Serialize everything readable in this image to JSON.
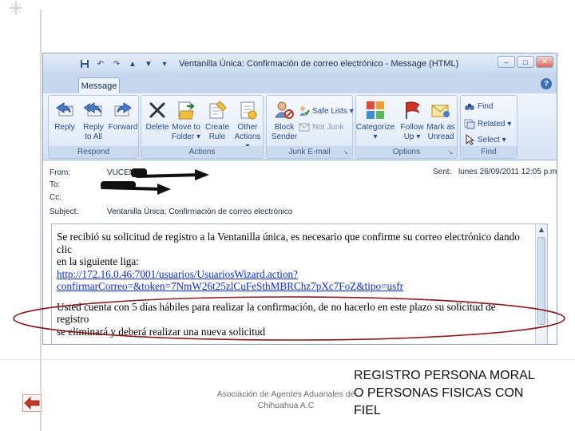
{
  "window": {
    "title": "Ventanilla Única: Confirmación de correo electrónico - Message (HTML)",
    "tab": "Message",
    "controls": [
      "–",
      "□",
      "✕"
    ]
  },
  "ribbon": {
    "respond": {
      "label": "Respond",
      "reply": "Reply",
      "reply_all": "Reply\nto All",
      "forward": "Forward"
    },
    "actions": {
      "label": "Actions",
      "delete": "Delete",
      "move_to_folder": "Move to\nFolder ▾",
      "create_rule": "Create\nRule",
      "other_actions": "Other\nActions ▾"
    },
    "junk": {
      "label": "Junk E-mail",
      "block_sender": "Block\nSender",
      "safe_lists": "Safe Lists ▾",
      "not_junk": "Not Junk"
    },
    "options": {
      "label": "Options",
      "categorize": "Categorize\n▾",
      "follow_up": "Follow\nUp ▾",
      "mark_as_unread": "Mark as\nUnread"
    },
    "find": {
      "label": "Find",
      "find": "Find",
      "related": "Related ▾",
      "select": "Select ▾"
    }
  },
  "headers": {
    "from_label": "From:",
    "from_value": "VUCEM",
    "to_label": "To:",
    "cc_label": "Cc:",
    "subject_label": "Subject:",
    "subject_value": "Ventanilla Única: Confirmación de correo electrónico",
    "sent_label": "Sent:",
    "sent_value": "lunes 26/09/2011 12:05 p.m."
  },
  "message": {
    "line1": "Se recibió su solicitud de registro a la Ventanilla única, es necesario que confirme su correo electrónico dando clic",
    "line2": "en la siguiente liga:",
    "link1": "http://172.16.0.46:7001/usuarios/UsuariosWizard.action?",
    "link2": "confirmarCorreo=&token=7NmW26t25zlCuFeSthMBRChz7pXc7FoZ&tipo=usfr",
    "notice1": "Usted cuenta con 5 días hábiles para realizar la confirmación, de no hacerlo en este plazo su solicitud de registro",
    "notice2": "se eliminará y deberá realizar una nueva solicitud"
  },
  "footer": {
    "assoc_line1": "Asociación de Agentes Aduanales de",
    "assoc_line2": "Chihuahua A.C",
    "caption_line1": "REGISTRO PERSONA MORAL",
    "caption_line2": "O PERSONAS FISICAS CON",
    "caption_line3": "FIEL"
  },
  "colors": {
    "annotation_ellipse": "#8b1a1a",
    "link": "#0b2bd6",
    "back_arrow": "#c0392b"
  }
}
